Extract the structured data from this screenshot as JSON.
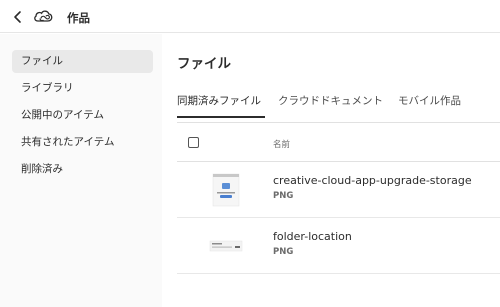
{
  "header": {
    "title": "作品"
  },
  "sidebar": {
    "items": [
      {
        "label": "ファイル"
      },
      {
        "label": "ライブラリ"
      },
      {
        "label": "公開中のアイテム"
      },
      {
        "label": "共有されたアイテム"
      },
      {
        "label": "削除済み"
      }
    ]
  },
  "main": {
    "title": "ファイル",
    "tabs": [
      {
        "label": "同期済みファイル"
      },
      {
        "label": "クラウドドキュメント"
      },
      {
        "label": "モバイル作品"
      }
    ],
    "table": {
      "column_name": "名前",
      "rows": [
        {
          "name": "creative-cloud-app-upgrade-storage",
          "type": "PNG"
        },
        {
          "name": "folder-location",
          "type": "PNG"
        }
      ]
    }
  }
}
